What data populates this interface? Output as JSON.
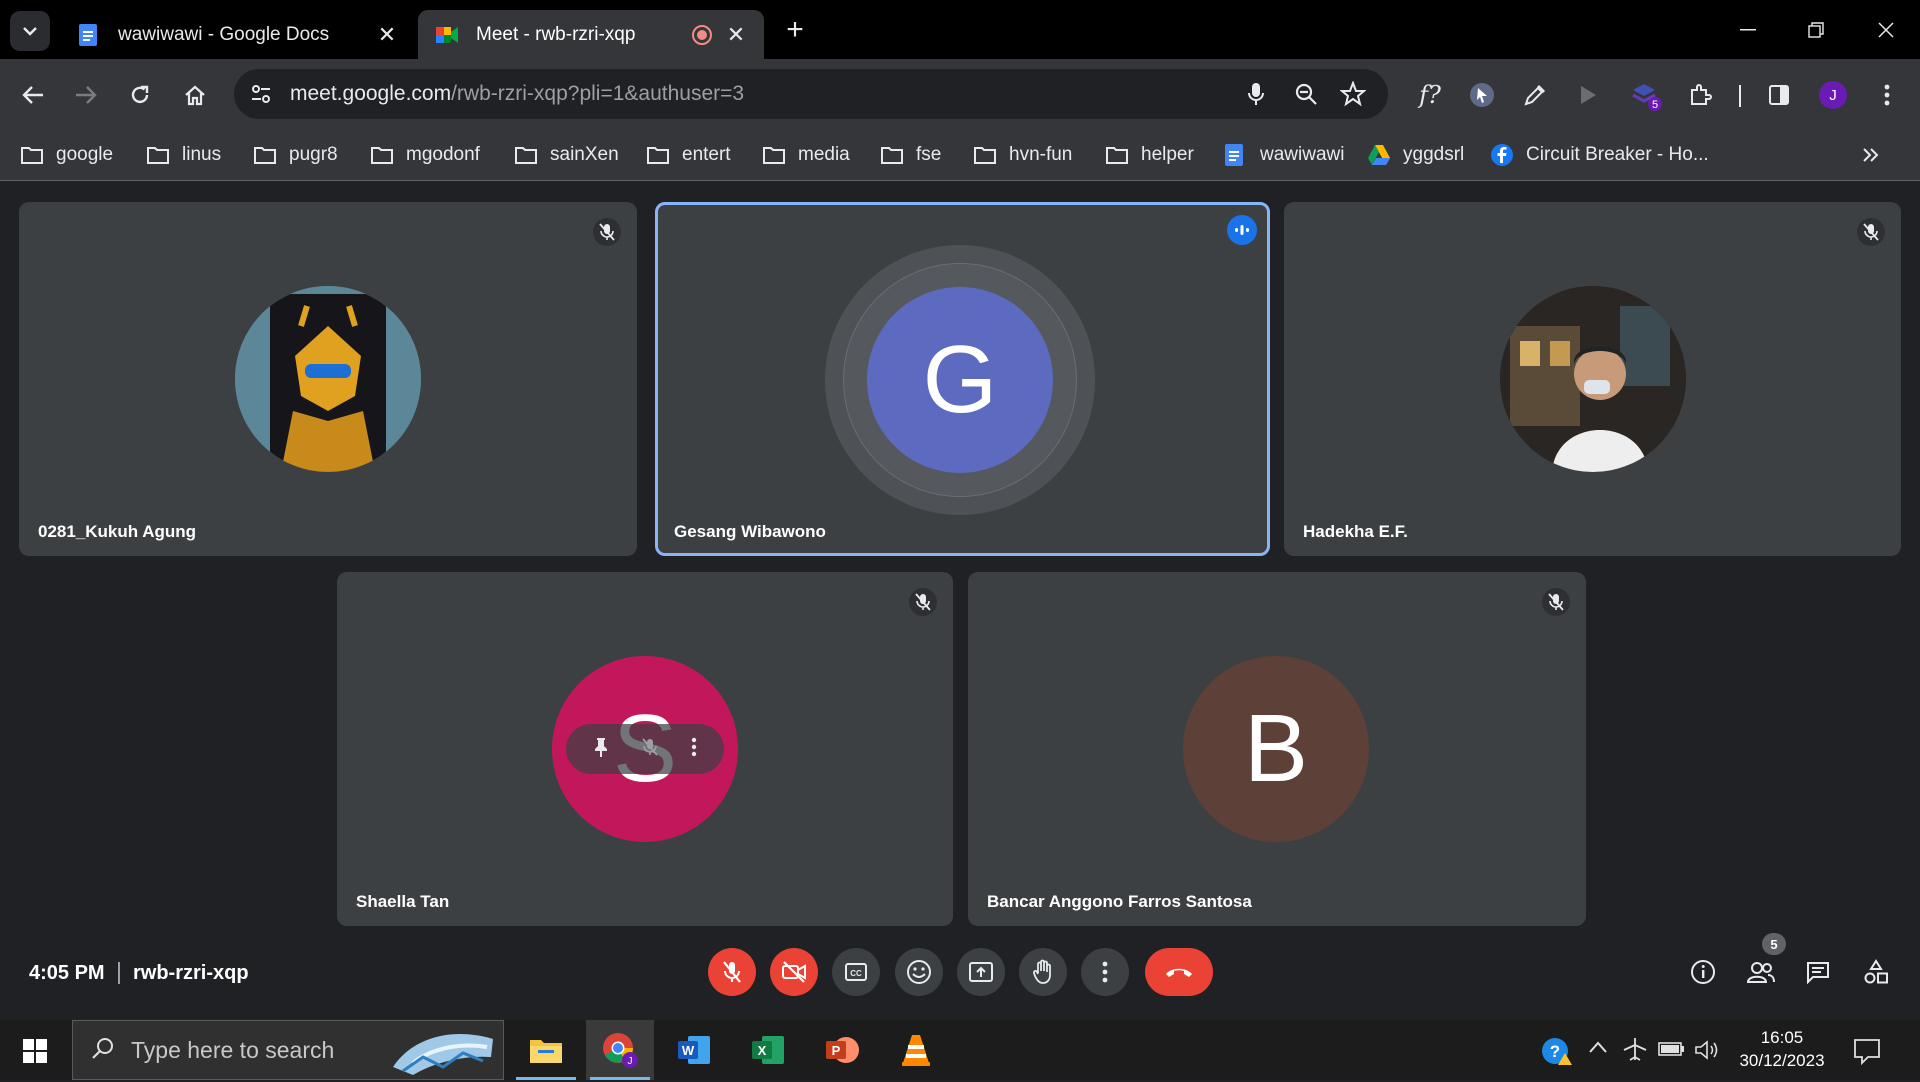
{
  "browser": {
    "tabs": [
      {
        "title": "wawiwawi - Google Docs",
        "favicon": "google-docs-icon"
      },
      {
        "title": "Meet - rwb-rzri-xqp",
        "favicon": "google-meet-icon",
        "recording": true
      }
    ],
    "address_bar": {
      "host": "meet.google.com",
      "path": "/rwb-rzri-xqp?pli=1&authuser=3"
    },
    "profile_initial": "J",
    "extension_badge": "5",
    "bookmarks": [
      {
        "label": "google",
        "icon": "folder-icon"
      },
      {
        "label": "linus",
        "icon": "folder-icon"
      },
      {
        "label": "pugr8",
        "icon": "folder-icon"
      },
      {
        "label": "mgodonf",
        "icon": "folder-icon"
      },
      {
        "label": "sainXen",
        "icon": "folder-icon"
      },
      {
        "label": "entert",
        "icon": "folder-icon"
      },
      {
        "label": "media",
        "icon": "folder-icon"
      },
      {
        "label": "fse",
        "icon": "folder-icon"
      },
      {
        "label": "hvn-fun",
        "icon": "folder-icon"
      },
      {
        "label": "helper",
        "icon": "folder-icon"
      },
      {
        "label": "wawiwawi",
        "icon": "google-docs-icon"
      },
      {
        "label": "yggdsrl",
        "icon": "google-drive-icon"
      },
      {
        "label": "Circuit Breaker - Ho...",
        "icon": "facebook-icon"
      }
    ]
  },
  "meet": {
    "participants": [
      {
        "name": "0281_Kukuh Agung",
        "avatar": "photo-bumblebee",
        "muted": true
      },
      {
        "name": "Gesang Wibawono",
        "initial": "G",
        "color": "#5c6bc0",
        "speaking": true
      },
      {
        "name": "Hadekha E.F.",
        "avatar": "photo-man-mask",
        "muted": true
      },
      {
        "name": "Shaella Tan",
        "initial": "S",
        "color": "#c2185b",
        "muted": true
      },
      {
        "name": "Bancar Anggono Farros Santosa",
        "initial": "B",
        "color": "#5d4037",
        "muted": true
      }
    ],
    "time": "4:05 PM",
    "meeting_code": "rwb-rzri-xqp",
    "people_count": "5",
    "accent": "#8ab4f8",
    "danger": "#ea4335"
  },
  "taskbar": {
    "search_placeholder": "Type here to search",
    "clock_time": "16:05",
    "clock_date": "30/12/2023"
  }
}
